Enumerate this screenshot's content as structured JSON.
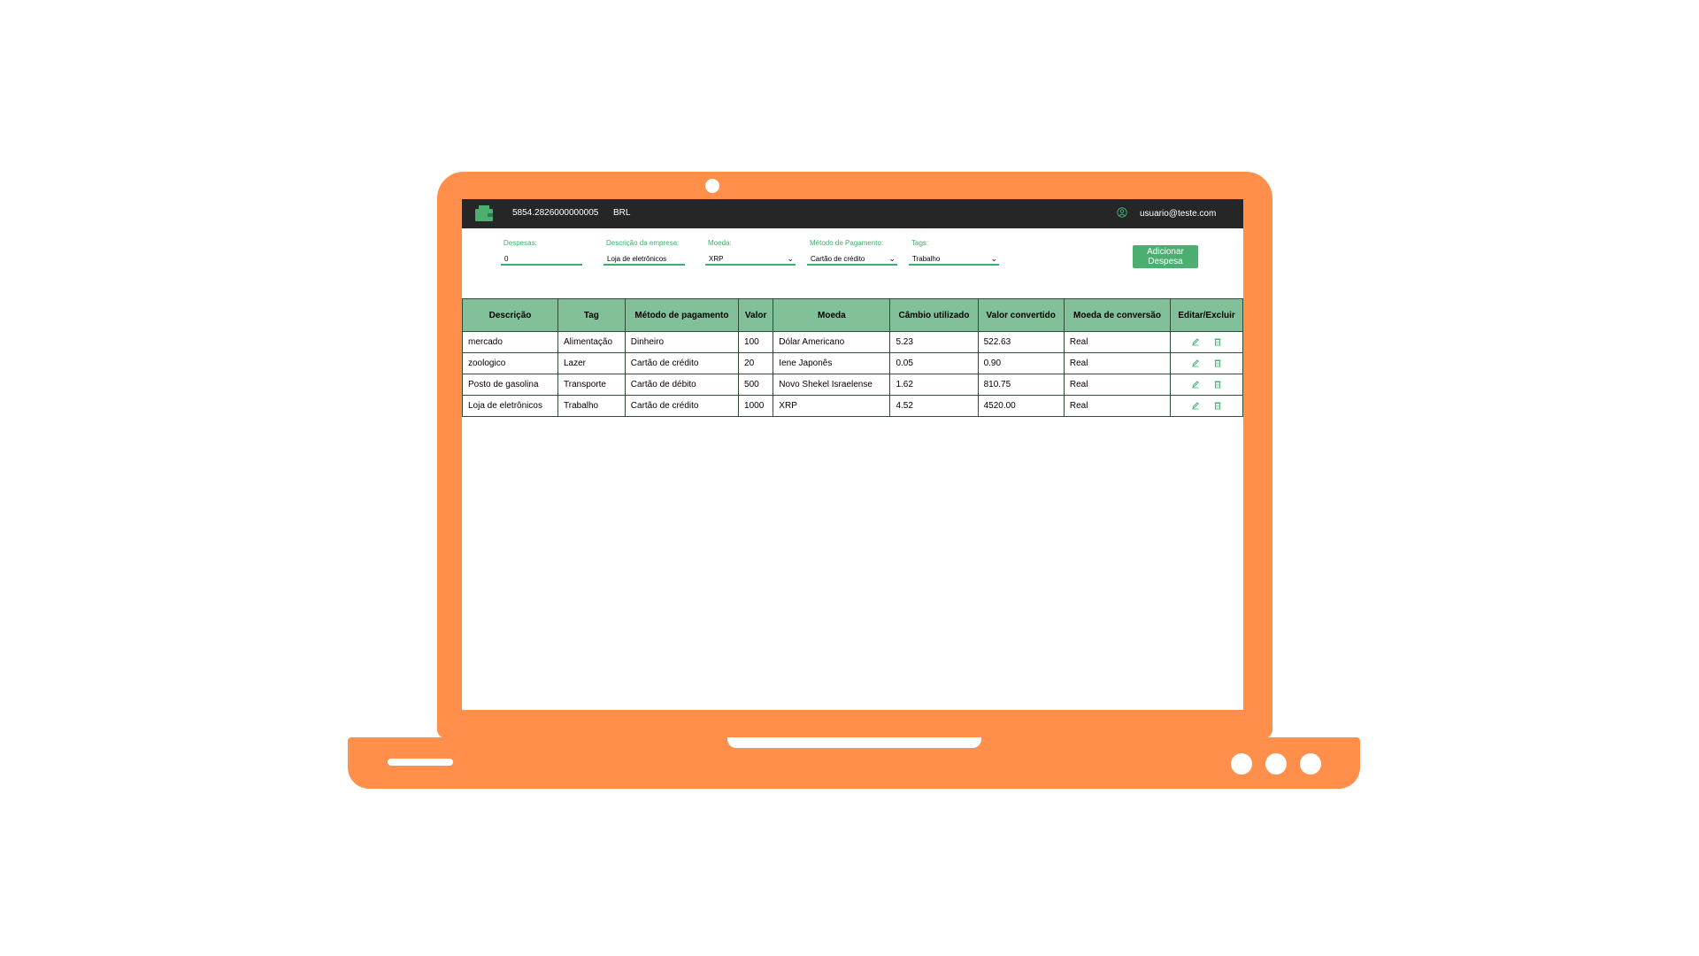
{
  "header": {
    "total": "5854.2826000000005",
    "currency": "BRL",
    "email": "usuario@teste.com",
    "accent": "#3daf6d"
  },
  "form": {
    "expense_label": "Despesas:",
    "expense_value": "0",
    "description_label": "Descrição da empresa:",
    "description_value": "Loja de eletrônicos",
    "currency_label": "Moeda:",
    "currency_value": "XRP",
    "method_label": "Método de Pagamento:",
    "method_value": "Cartão de crédito",
    "tag_label": "Tags:",
    "tag_value": "Trabalho",
    "add_label": "Adicionar Despesa"
  },
  "table": {
    "headers": [
      "Descrição",
      "Tag",
      "Método de pagamento",
      "Valor",
      "Moeda",
      "Câmbio utilizado",
      "Valor convertido",
      "Moeda de conversão",
      "Editar/Excluir"
    ],
    "rows": [
      [
        "mercado",
        "Alimentação",
        "Dinheiro",
        "100",
        "Dólar Americano",
        "5.23",
        "522.63",
        "Real"
      ],
      [
        "zoologico",
        "Lazer",
        "Cartão de crédito",
        "20",
        "Iene Japonês",
        "0.05",
        "0.90",
        "Real"
      ],
      [
        "Posto de gasolina",
        "Transporte",
        "Cartão de débito",
        "500",
        "Novo Shekel Israelense",
        "1.62",
        "810.75",
        "Real"
      ],
      [
        "Loja de eletrônicos",
        "Trabalho",
        "Cartão de crédito",
        "1000",
        "XRP",
        "4.52",
        "4520.00",
        "Real"
      ]
    ]
  },
  "icons": {
    "wallet": "wallet-icon",
    "user": "user-icon",
    "edit": "edit-icon",
    "delete": "trash-icon"
  },
  "colors": {
    "laptop": "#FF8F4A",
    "topbar": "#262626",
    "table_header": "#82c09a",
    "button": "#4caf71"
  }
}
